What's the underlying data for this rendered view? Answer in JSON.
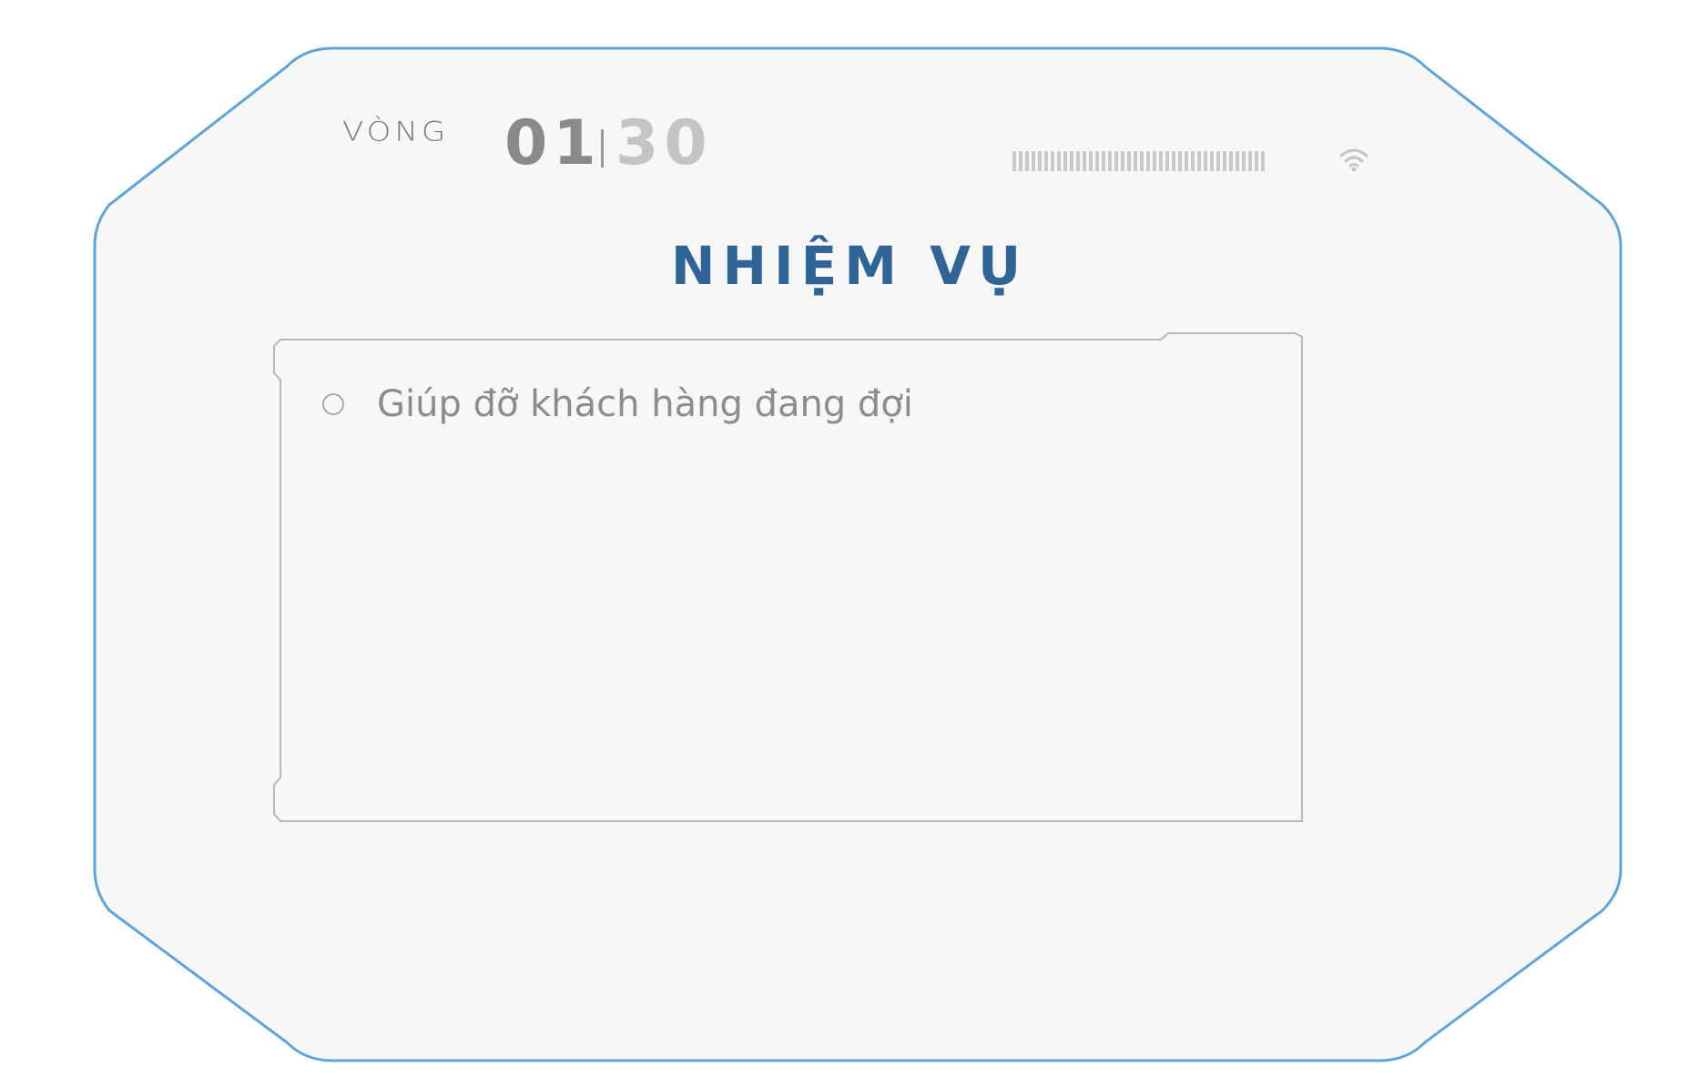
{
  "header": {
    "round_label": "VÒNG",
    "timer_minutes": "01",
    "timer_seconds": "30"
  },
  "title": "NHIỆM VỤ",
  "tasks": [
    {
      "label": "Giúp đỡ khách hàng đang đợi",
      "done": false
    }
  ],
  "icons": {
    "signal": "signal-bars-icon",
    "wifi": "wifi-icon",
    "bullet": "empty-circle-icon"
  },
  "colors": {
    "frame_border": "#5fa4d8",
    "panel_bg": "#f7f7f7",
    "title": "#2f6596",
    "muted_text": "#8c8c8c"
  }
}
